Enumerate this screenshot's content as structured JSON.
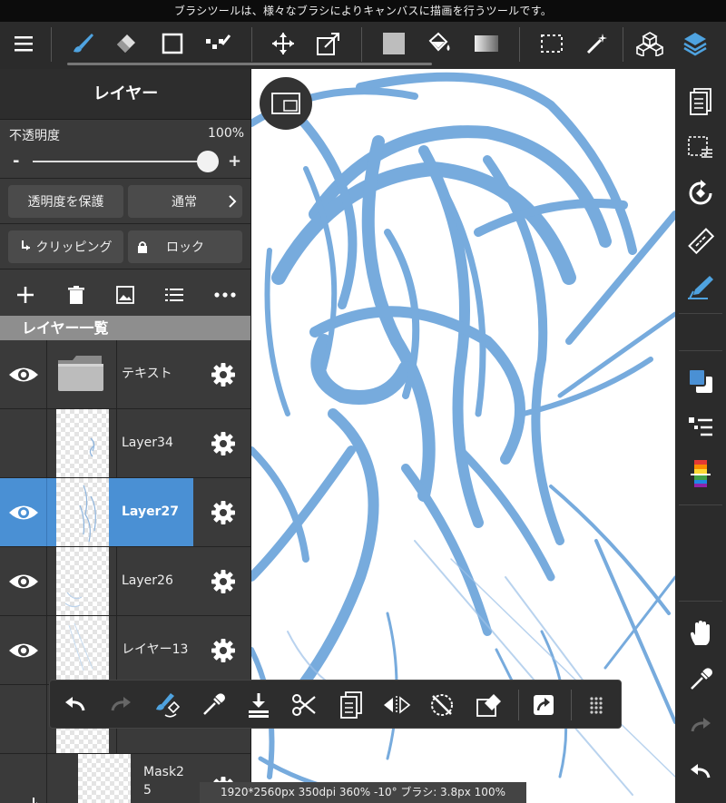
{
  "tip": "ブラシツールは、様々なブラシによりキャンバスに描画を行うツールです。",
  "toolbar": {
    "items": [
      {
        "name": "menu-icon"
      },
      {
        "name": "brush-icon"
      },
      {
        "name": "eraser-icon"
      },
      {
        "name": "rectangle-icon"
      },
      {
        "name": "dot-brush-icon"
      },
      {
        "name": "move-icon"
      },
      {
        "name": "transform-icon"
      },
      {
        "name": "fill-color-icon"
      },
      {
        "name": "bucket-icon"
      },
      {
        "name": "gradient-icon"
      },
      {
        "name": "select-icon"
      },
      {
        "name": "magic-wand-icon"
      },
      {
        "name": "material-icon"
      },
      {
        "name": "layers-icon"
      }
    ],
    "accent": "#4fa3e0"
  },
  "layer_panel": {
    "title": "レイヤー",
    "opacity_label": "不透明度",
    "opacity_value": "100%",
    "opacity_fraction": 1.0,
    "minus": "-",
    "plus": "+",
    "protect_alpha": "透明度を保護",
    "blend_mode": "通常",
    "clipping": "クリッピング",
    "lock": "ロック",
    "list_header": "レイヤー一覧",
    "layers": [
      {
        "name": "テキスト",
        "visible": true,
        "type": "folder"
      },
      {
        "name": "Layer34",
        "visible": false,
        "type": "layer"
      },
      {
        "name": "Layer27",
        "visible": true,
        "type": "layer",
        "selected": true
      },
      {
        "name": "Layer26",
        "visible": true,
        "type": "layer"
      },
      {
        "name": "レイヤー13",
        "visible": true,
        "type": "layer"
      },
      {
        "name": "",
        "visible": false,
        "type": "layer"
      },
      {
        "name": "Mask2\n5",
        "visible": false,
        "type": "clip"
      }
    ],
    "selected_color": "#4a90d4"
  },
  "status": "1920*2560px 350dpi 360% -10° ブラシ: 3.8px 100%",
  "stroke_color": "#4a8fd2"
}
